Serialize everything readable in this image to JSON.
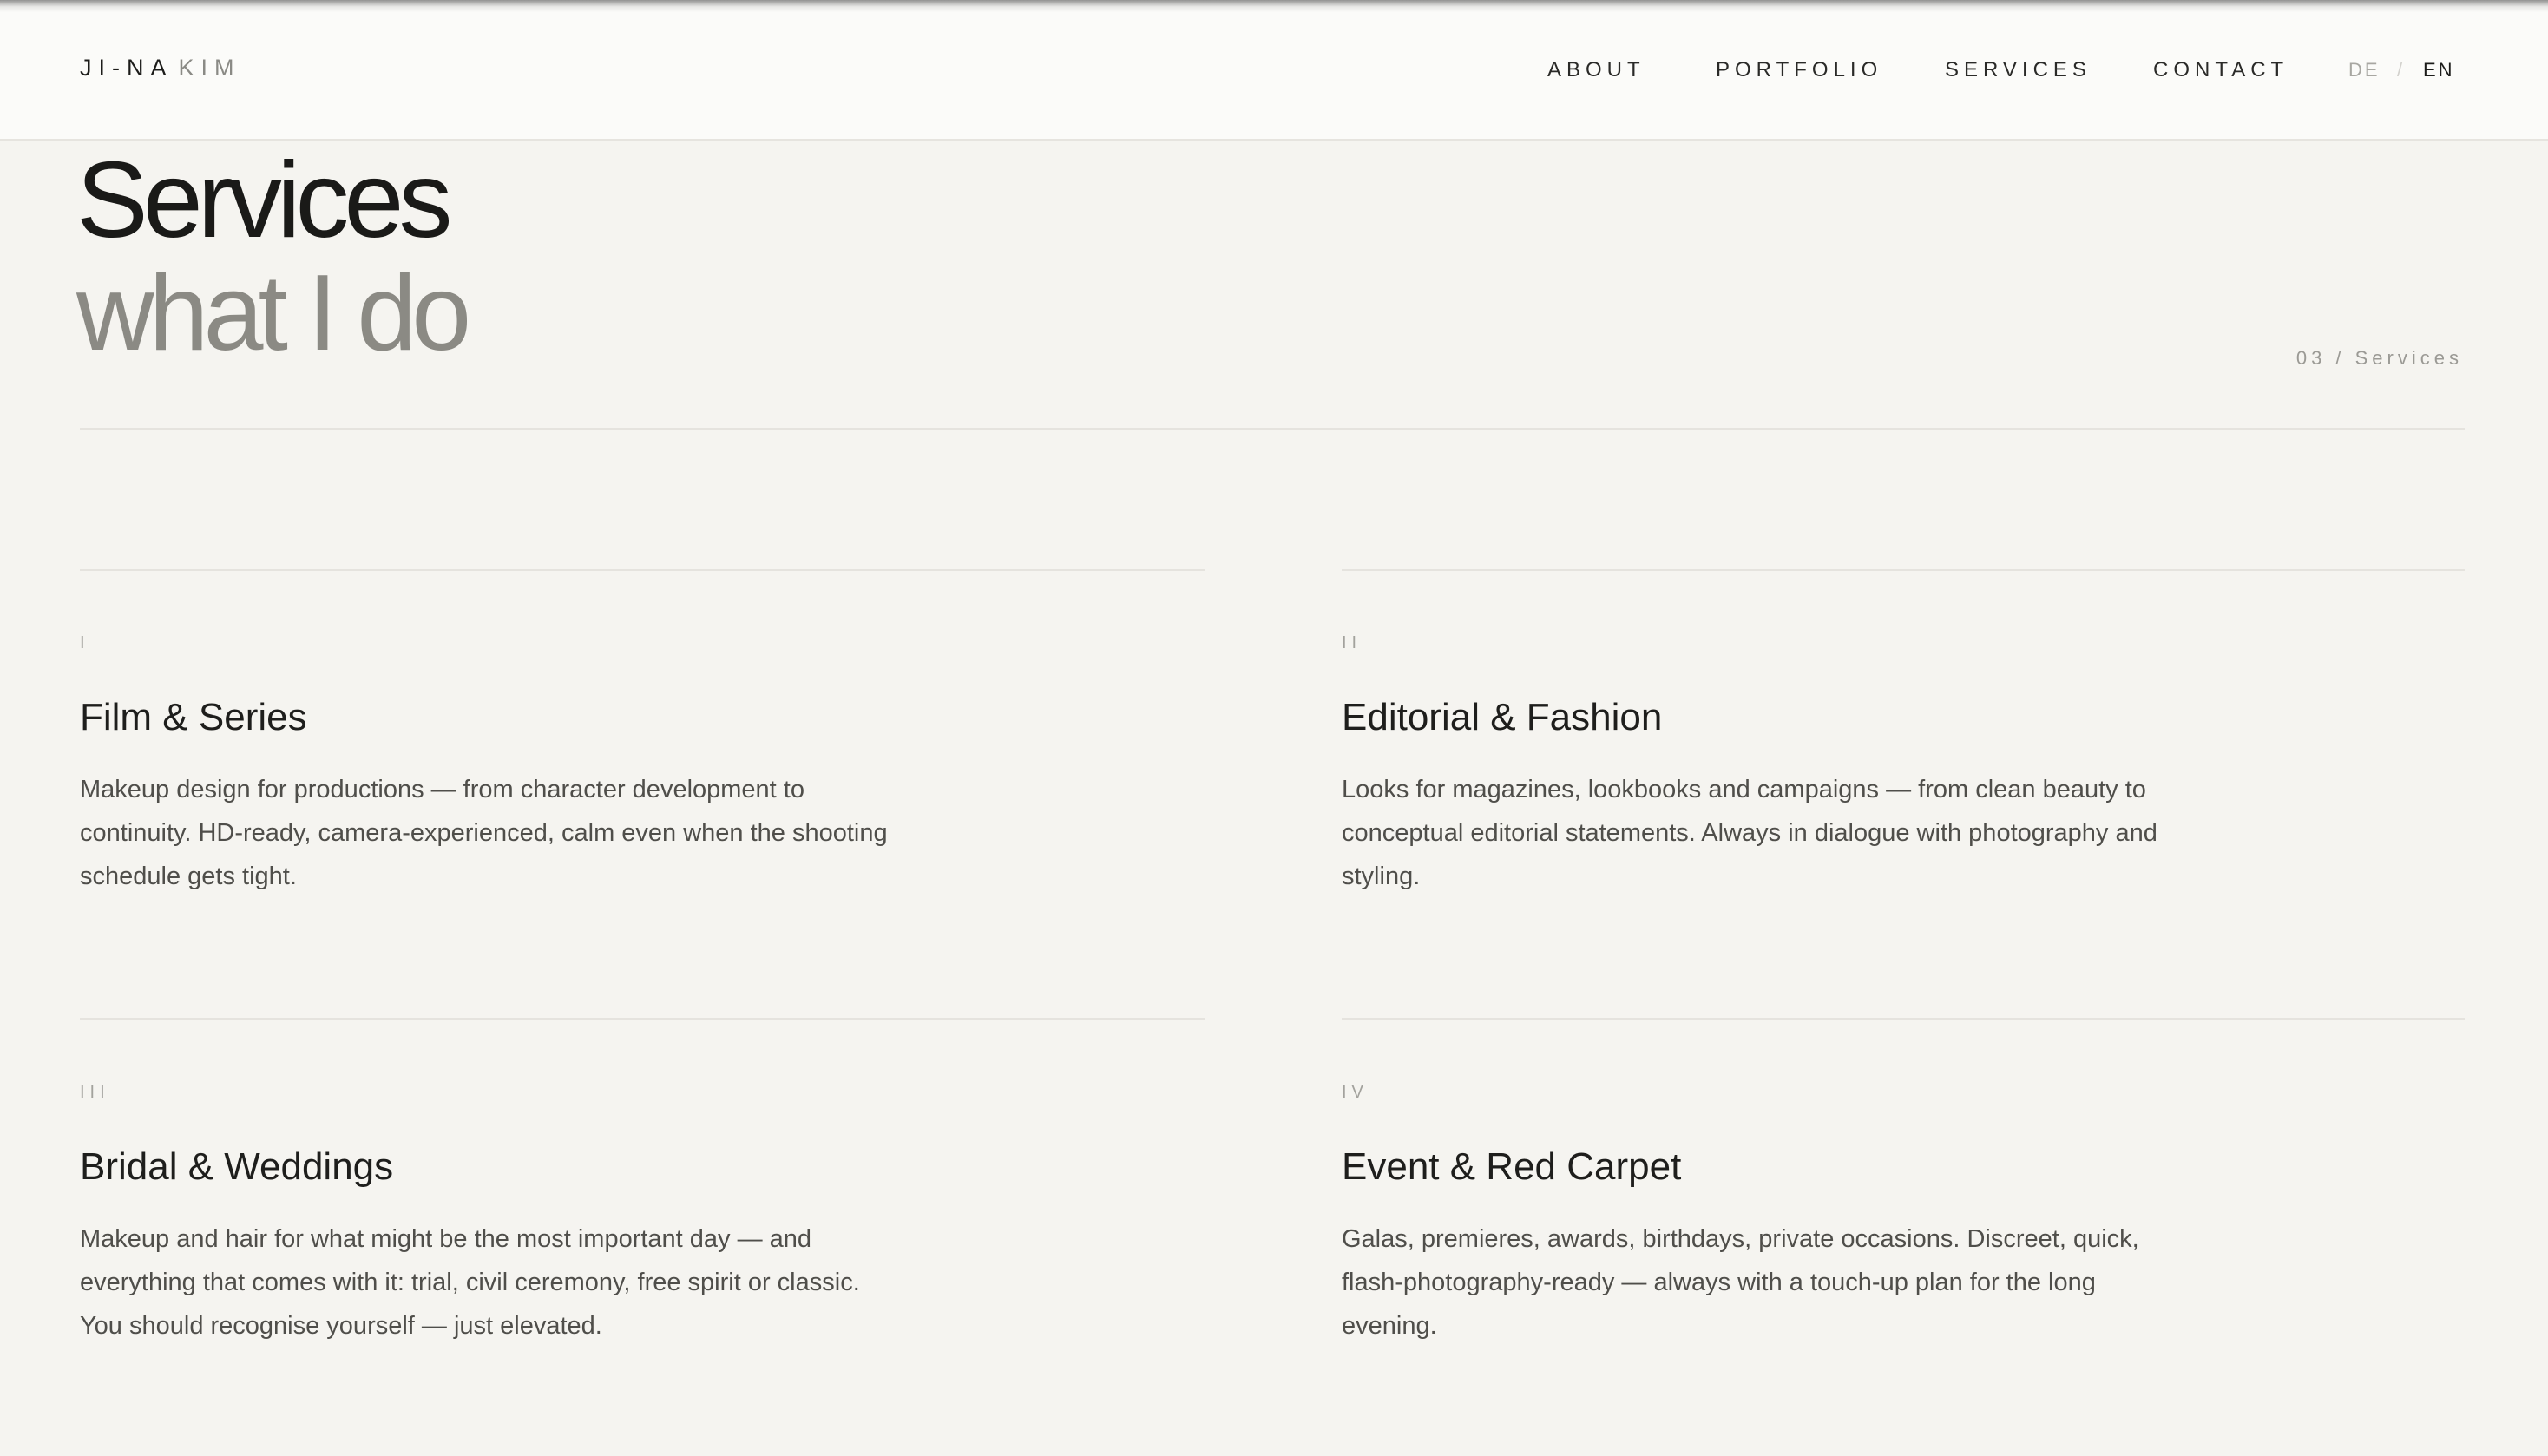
{
  "header": {
    "logo_first": "JI-NA",
    "logo_last": "KIM",
    "nav": [
      {
        "label": "ABOUT"
      },
      {
        "label": "PORTFOLIO"
      },
      {
        "label": "SERVICES"
      },
      {
        "label": "CONTACT"
      }
    ],
    "lang": {
      "de": "DE",
      "separator": "/",
      "en": "EN"
    }
  },
  "hero": {
    "title": "Services",
    "subtitle": "what I do",
    "section_tag": "03 / Services"
  },
  "services": [
    {
      "numeral": "I",
      "name": "Film & Series",
      "description": "Makeup design for productions — from character development to continuity. HD-ready, camera-experienced, calm even when the shooting schedule gets tight."
    },
    {
      "numeral": "II",
      "name": "Editorial & Fashion",
      "description": "Looks for magazines, lookbooks and campaigns — from clean beauty to conceptual editorial statements. Always in dialogue with photography and styling."
    },
    {
      "numeral": "III",
      "name": "Bridal & Weddings",
      "description": "Makeup and hair for what might be the most important day — and everything that comes with it: trial, civil ceremony, free spirit or classic. You should recognise yourself — just elevated."
    },
    {
      "numeral": "IV",
      "name": "Event & Red Carpet",
      "description": "Galas, premieres, awards, birthdays, private occasions. Discreet, quick, flash-photography-ready — always with a touch-up plan for the long evening."
    }
  ]
}
